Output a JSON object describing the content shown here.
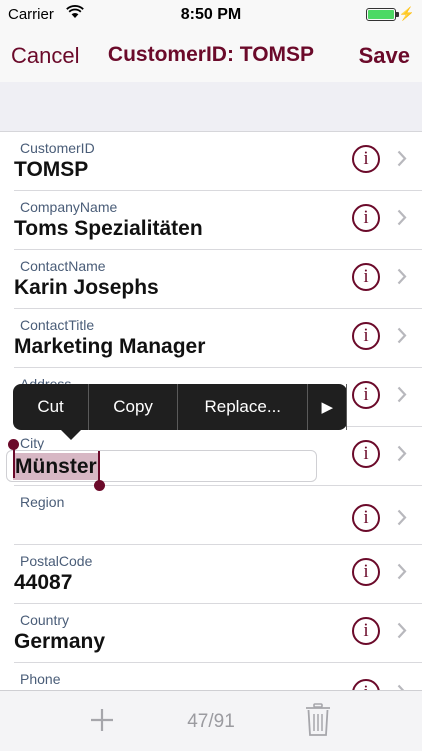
{
  "status": {
    "carrier": "Carrier",
    "time": "8:50 PM",
    "charge_glyph": "⚡"
  },
  "nav": {
    "cancel_label": "Cancel",
    "title": "CustomerID: TOMSP",
    "save_label": "Save"
  },
  "fields": [
    {
      "label": "CustomerID",
      "value": "TOMSP"
    },
    {
      "label": "CompanyName",
      "value": "Toms Spezialitäten"
    },
    {
      "label": "ContactName",
      "value": "Karin Josephs"
    },
    {
      "label": "ContactTitle",
      "value": "Marketing Manager"
    },
    {
      "label": "Address",
      "value": ""
    },
    {
      "label": "City",
      "value": "Münster"
    },
    {
      "label": "Region",
      "value": ""
    },
    {
      "label": "PostalCode",
      "value": "44087"
    },
    {
      "label": "Country",
      "value": "Germany"
    },
    {
      "label": "Phone",
      "value": ""
    }
  ],
  "info_glyph": "i",
  "edit_menu": {
    "cut": "Cut",
    "copy": "Copy",
    "replace": "Replace...",
    "more": "▶"
  },
  "toolbar": {
    "counter": "47/91"
  },
  "colors": {
    "accent": "#6b0a2a",
    "selection": "#d7b7c4",
    "menu": "#1f1f1f"
  }
}
